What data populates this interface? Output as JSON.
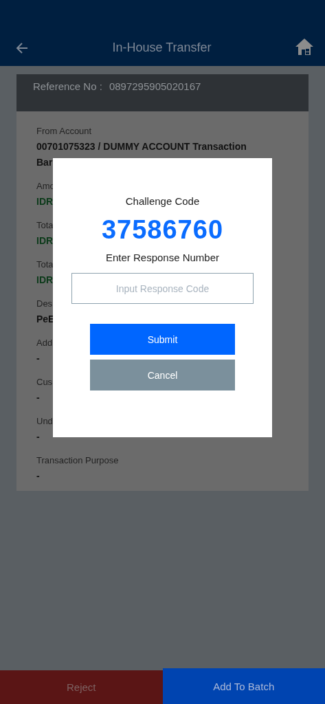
{
  "header": {
    "title": "In-House Transfer"
  },
  "reference": {
    "label": "Reference No :",
    "value": "0897295905020167"
  },
  "details": [
    {
      "label": "From Account",
      "values": [
        {
          "text": "00701075323 / DUMMY ACCOUNT Transaction",
          "kind": "plain"
        },
        {
          "text": "Bar",
          "kind": "plain"
        }
      ]
    },
    {
      "label": "Amo",
      "values": [
        {
          "text": "IDR",
          "kind": "amount"
        }
      ]
    },
    {
      "label": "Tota",
      "values": [
        {
          "text": "IDR",
          "kind": "amount"
        }
      ]
    },
    {
      "label": "Tota",
      "values": [
        {
          "text": "IDR",
          "kind": "amount"
        }
      ]
    },
    {
      "label": "Des",
      "values": [
        {
          "text": "PeE",
          "kind": "plain"
        }
      ]
    },
    {
      "label": "Add",
      "values": [
        {
          "text": "-",
          "kind": "plain"
        }
      ]
    },
    {
      "label": "Cus",
      "values": [
        {
          "text": "-",
          "kind": "plain"
        }
      ]
    },
    {
      "label": "Und",
      "values": [
        {
          "text": "-",
          "kind": "plain"
        }
      ]
    },
    {
      "label": "Transaction Purpose",
      "values": [
        {
          "text": "-",
          "kind": "plain"
        }
      ]
    }
  ],
  "dialog": {
    "title": "Challenge Code",
    "code": "37586760",
    "prompt": "Enter Response Number",
    "input": {
      "placeholder": "Input Response Code"
    },
    "buttons": [
      {
        "label": "Submit",
        "kind": "primary"
      },
      {
        "label": "Cancel",
        "kind": "secondary"
      }
    ]
  },
  "footer": [
    {
      "label": "Reject",
      "kind": "reject"
    },
    {
      "label": "Add To Batch",
      "kind": "add"
    }
  ]
}
